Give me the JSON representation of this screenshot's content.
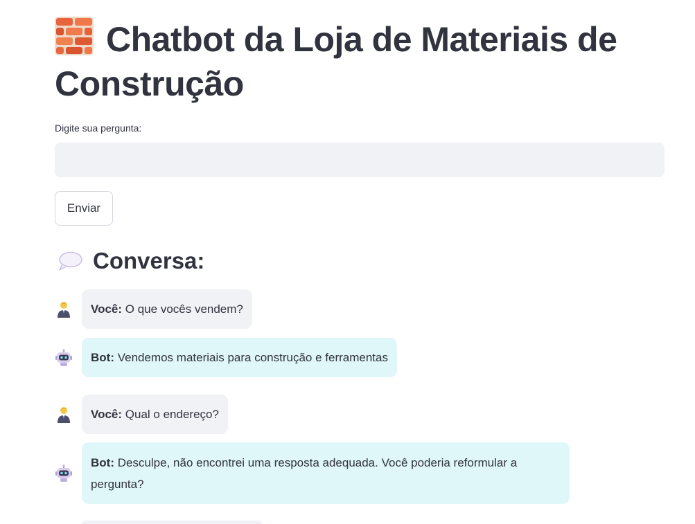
{
  "header": {
    "title": "Chatbot da Loja de Materiais de Construção",
    "title_icon": "brick-icon"
  },
  "form": {
    "label": "Digite sua pergunta:",
    "input_value": "",
    "input_placeholder": "",
    "send_label": "Enviar"
  },
  "conversation": {
    "title": "Conversa:",
    "title_icon": "speech-bubble-icon",
    "messages": [
      {
        "role": "user",
        "avatar_icon": "person-icon",
        "speaker": "Você:",
        "text": "O que vocês vendem?"
      },
      {
        "role": "bot",
        "avatar_icon": "robot-icon",
        "speaker": "Bot:",
        "text": "Vendemos materiais para construção e ferramentas"
      },
      {
        "role": "user",
        "avatar_icon": "person-icon",
        "speaker": "Você:",
        "text": "Qual o endereço?"
      },
      {
        "role": "bot",
        "avatar_icon": "robot-icon",
        "speaker": "Bot:",
        "text": "Desculpe, não encontrei uma resposta adequada. Você poderia reformular a pergunta?"
      }
    ]
  },
  "colors": {
    "text": "#31333f",
    "user_bubble": "#f0f2f6",
    "bot_bubble": "#e0f7f9",
    "input_background": "#f0f2f6"
  }
}
